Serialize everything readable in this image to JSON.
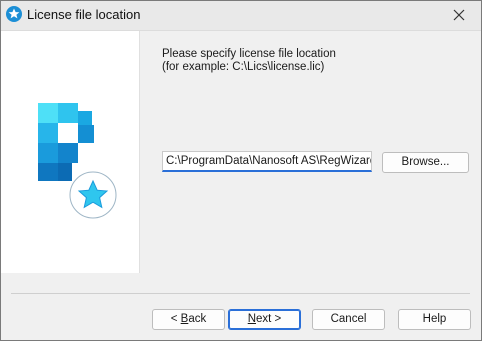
{
  "window": {
    "title": "License file location",
    "title_icon": "star-icon",
    "close_icon": "close-icon"
  },
  "instruction": {
    "line1": "Please specify license file location",
    "line2": "(for example: C:\\Lics\\license.lic)"
  },
  "path_input": {
    "value": "C:\\ProgramData\\Nanosoft AS\\RegWizard\\Li"
  },
  "buttons": {
    "browse": "Browse...",
    "back_prefix": "< ",
    "back_mnemonic": "B",
    "back_rest": "ack",
    "next_mnemonic": "N",
    "next_rest": "ext >",
    "cancel": "Cancel",
    "help": "Help"
  },
  "colors": {
    "accent": "#2a6fd8",
    "logo_blue": "#1c8fd6",
    "logo_cyan": "#4fd8f5"
  }
}
